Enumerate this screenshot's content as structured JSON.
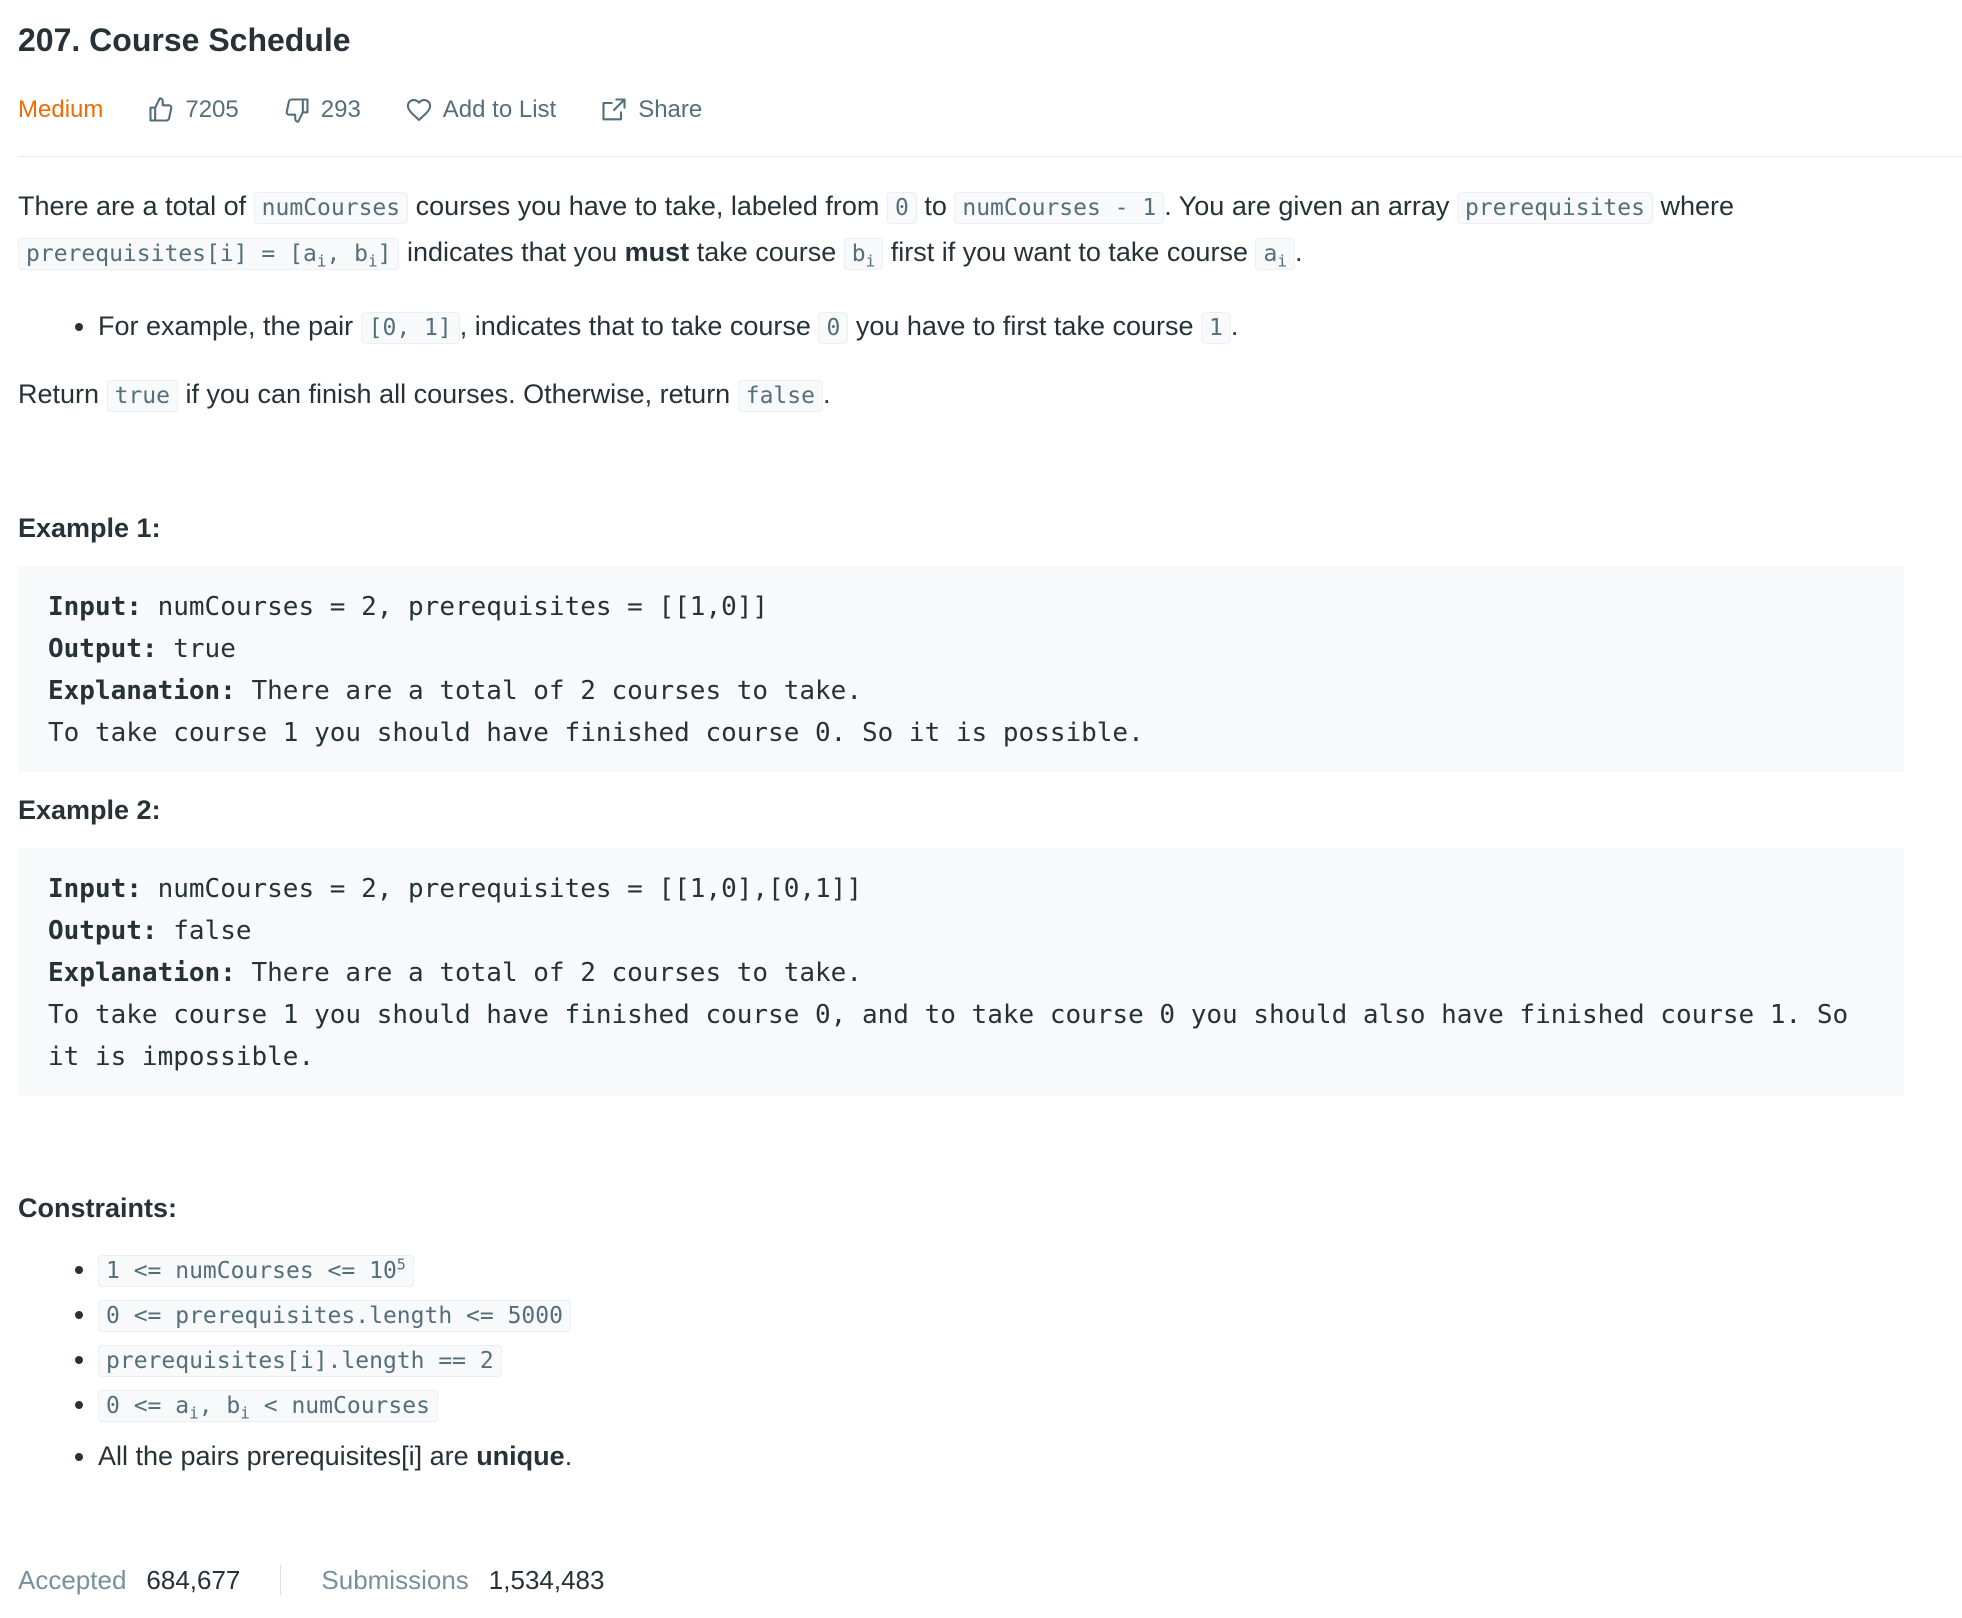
{
  "problem": {
    "title": "207. Course Schedule",
    "difficulty": "Medium",
    "likes": "7205",
    "dislikes": "293",
    "add_to_list": "Add to List",
    "share": "Share"
  },
  "description": {
    "p1_a": "There are a total of",
    "p1_code_numCourses": "numCourses",
    "p1_b": "courses you have to take, labeled from",
    "p1_code_0": "0",
    "p1_c": "to",
    "p1_code_numCourses_minus": "numCourses - 1",
    "p1_d": ". You are given an array",
    "p1_code_prereq": "prerequisites",
    "p1_e": "where",
    "p1_code_prereq_i": "prerequisites[i] = [a",
    "p1_code_sub_i1": "i",
    "p1_code_comma_b": ", b",
    "p1_code_sub_i2": "i",
    "p1_code_close": "]",
    "p1_f": "indicates that you",
    "p1_must": "must",
    "p1_g": "take course",
    "p1_code_b": "b",
    "p1_code_b_sub": "i",
    "p1_h": "first if you want to take course",
    "p1_code_a": "a",
    "p1_code_a_sub": "i",
    "p1_end": ".",
    "bullet_a": "For example, the pair",
    "bullet_code_pair": "[0, 1]",
    "bullet_b": ", indicates that to take course",
    "bullet_code_0": "0",
    "bullet_c": "you have to first take course",
    "bullet_code_1": "1",
    "bullet_end": ".",
    "p2_a": "Return",
    "p2_code_true": "true",
    "p2_b": "if you can finish all courses. Otherwise, return",
    "p2_code_false": "false",
    "p2_end": "."
  },
  "examples": [
    {
      "heading": "Example 1:",
      "input_label": "Input:",
      "input": " numCourses = 2, prerequisites = [[1,0]]",
      "output_label": "Output:",
      "output": " true",
      "explanation_label": "Explanation:",
      "explanation": " There are a total of 2 courses to take.\nTo take course 1 you should have finished course 0. So it is possible."
    },
    {
      "heading": "Example 2:",
      "input_label": "Input:",
      "input": " numCourses = 2, prerequisites = [[1,0],[0,1]]",
      "output_label": "Output:",
      "output": " false",
      "explanation_label": "Explanation:",
      "explanation": " There are a total of 2 courses to take.\nTo take course 1 you should have finished course 0, and to take course 0 you should also have finished course 1. So it is impossible."
    }
  ],
  "constraints": {
    "heading": "Constraints:",
    "c1_code": "1 <= numCourses <= 10",
    "c1_sup": "5",
    "c2_code": "0 <= prerequisites.length <= 5000",
    "c3_code": "prerequisites[i].length == 2",
    "c4_code_a": "0 <= a",
    "c4_sub_a": "i",
    "c4_code_b": ", b",
    "c4_sub_b": "i",
    "c4_code_c": " < numCourses",
    "c5_a": "All the pairs prerequisites[i] are",
    "c5_bold": "unique",
    "c5_end": "."
  },
  "stats": {
    "accepted_label": "Accepted",
    "accepted_value": "684,677",
    "submissions_label": "Submissions",
    "submissions_value": "1,534,483"
  },
  "colors": {
    "difficulty_medium": "#ef6c00",
    "text": "#263238",
    "muted": "#546e7a",
    "code_bg": "#f7f9fa"
  },
  "icons": [
    "thumbs-up-icon",
    "thumbs-down-icon",
    "heart-icon",
    "share-icon"
  ]
}
